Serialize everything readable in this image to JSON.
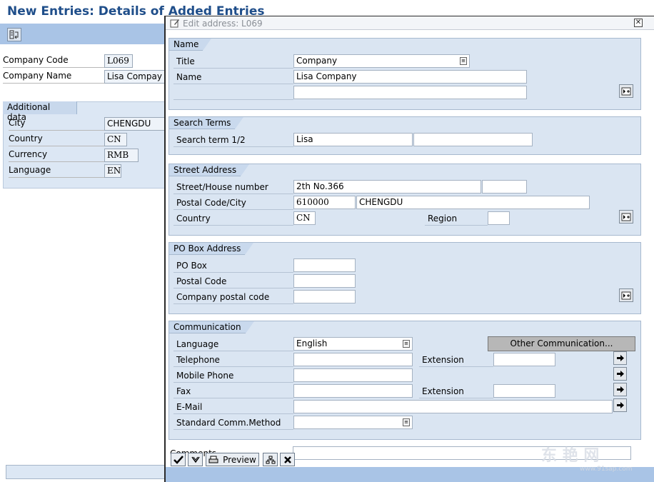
{
  "background": {
    "title": "New Entries: Details of Added Entries",
    "company_code_label": "Company Code",
    "company_code_value": "L069",
    "company_name_label": "Company Name",
    "company_name_value": "Lisa Compay",
    "additional_data": {
      "title": "Additional data",
      "city_label": "City",
      "city_value": "CHENGDU",
      "country_label": "Country",
      "country_value": "CN",
      "currency_label": "Currency",
      "currency_value": "RMB",
      "language_label": "Language",
      "language_value": "EN"
    }
  },
  "dialog": {
    "title": "Edit address:  L069",
    "close_glyph": "✕",
    "name_group": {
      "title": "Name",
      "title_label": "Title",
      "title_value": "Company",
      "name_label": "Name",
      "name_value": "Lisa Company",
      "name2_value": ""
    },
    "search_group": {
      "title": "Search Terms",
      "label": "Search term 1/2",
      "term1": "Lisa",
      "term2": ""
    },
    "street_group": {
      "title": "Street Address",
      "street_label": "Street/House number",
      "street_value": "2th No.366",
      "house_value": "",
      "postal_city_label": "Postal Code/City",
      "postal_value": "610000",
      "city_value": "CHENGDU",
      "country_label": "Country",
      "country_value": "CN",
      "region_label": "Region",
      "region_value": ""
    },
    "pobox_group": {
      "title": "PO Box Address",
      "po_box_label": "PO Box",
      "postal_code_label": "Postal Code",
      "company_postal_label": "Company postal code"
    },
    "comm_group": {
      "title": "Communication",
      "language_label": "Language",
      "language_value": "English",
      "other_comm_label": "Other Communication...",
      "telephone_label": "Telephone",
      "extension_label": "Extension",
      "mobile_label": "Mobile Phone",
      "fax_label": "Fax",
      "fax_extension_label": "Extension",
      "email_label": "E-Mail",
      "std_comm_label": "Standard Comm.Method"
    },
    "comments_label": "Comments",
    "footer": {
      "preview_label": "Preview"
    }
  },
  "watermark": {
    "text": "东 艳 网",
    "sub": "www.91sap.com"
  },
  "colors": {
    "title_blue": "#1f4e8a",
    "group_bg": "#dae5f2",
    "toolbar_bg": "#a9c4e6"
  }
}
